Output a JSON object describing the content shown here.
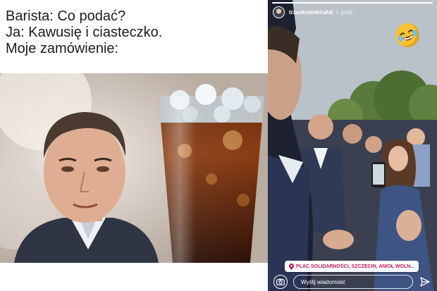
{
  "meme": {
    "lines": [
      "Barista: Co podać?",
      "Ja: Kawusię i ciasteczko.",
      "Moje zamówienie:"
    ]
  },
  "story": {
    "username": "trzaskowskirafal",
    "time_ago": "1 godz.",
    "location": "PLAC SOLIDARNOŚCI, SZCZECIN, ANIOŁ WOLN...",
    "message_placeholder": "Wyślij wiadomość",
    "icons": {
      "camera": "camera-icon",
      "send": "send-icon",
      "pin": "location-pin-icon",
      "emoji": "laughing-emoji-icon"
    }
  },
  "colors": {
    "accent_location": "#c2185b",
    "emoji": "#f6c233"
  }
}
